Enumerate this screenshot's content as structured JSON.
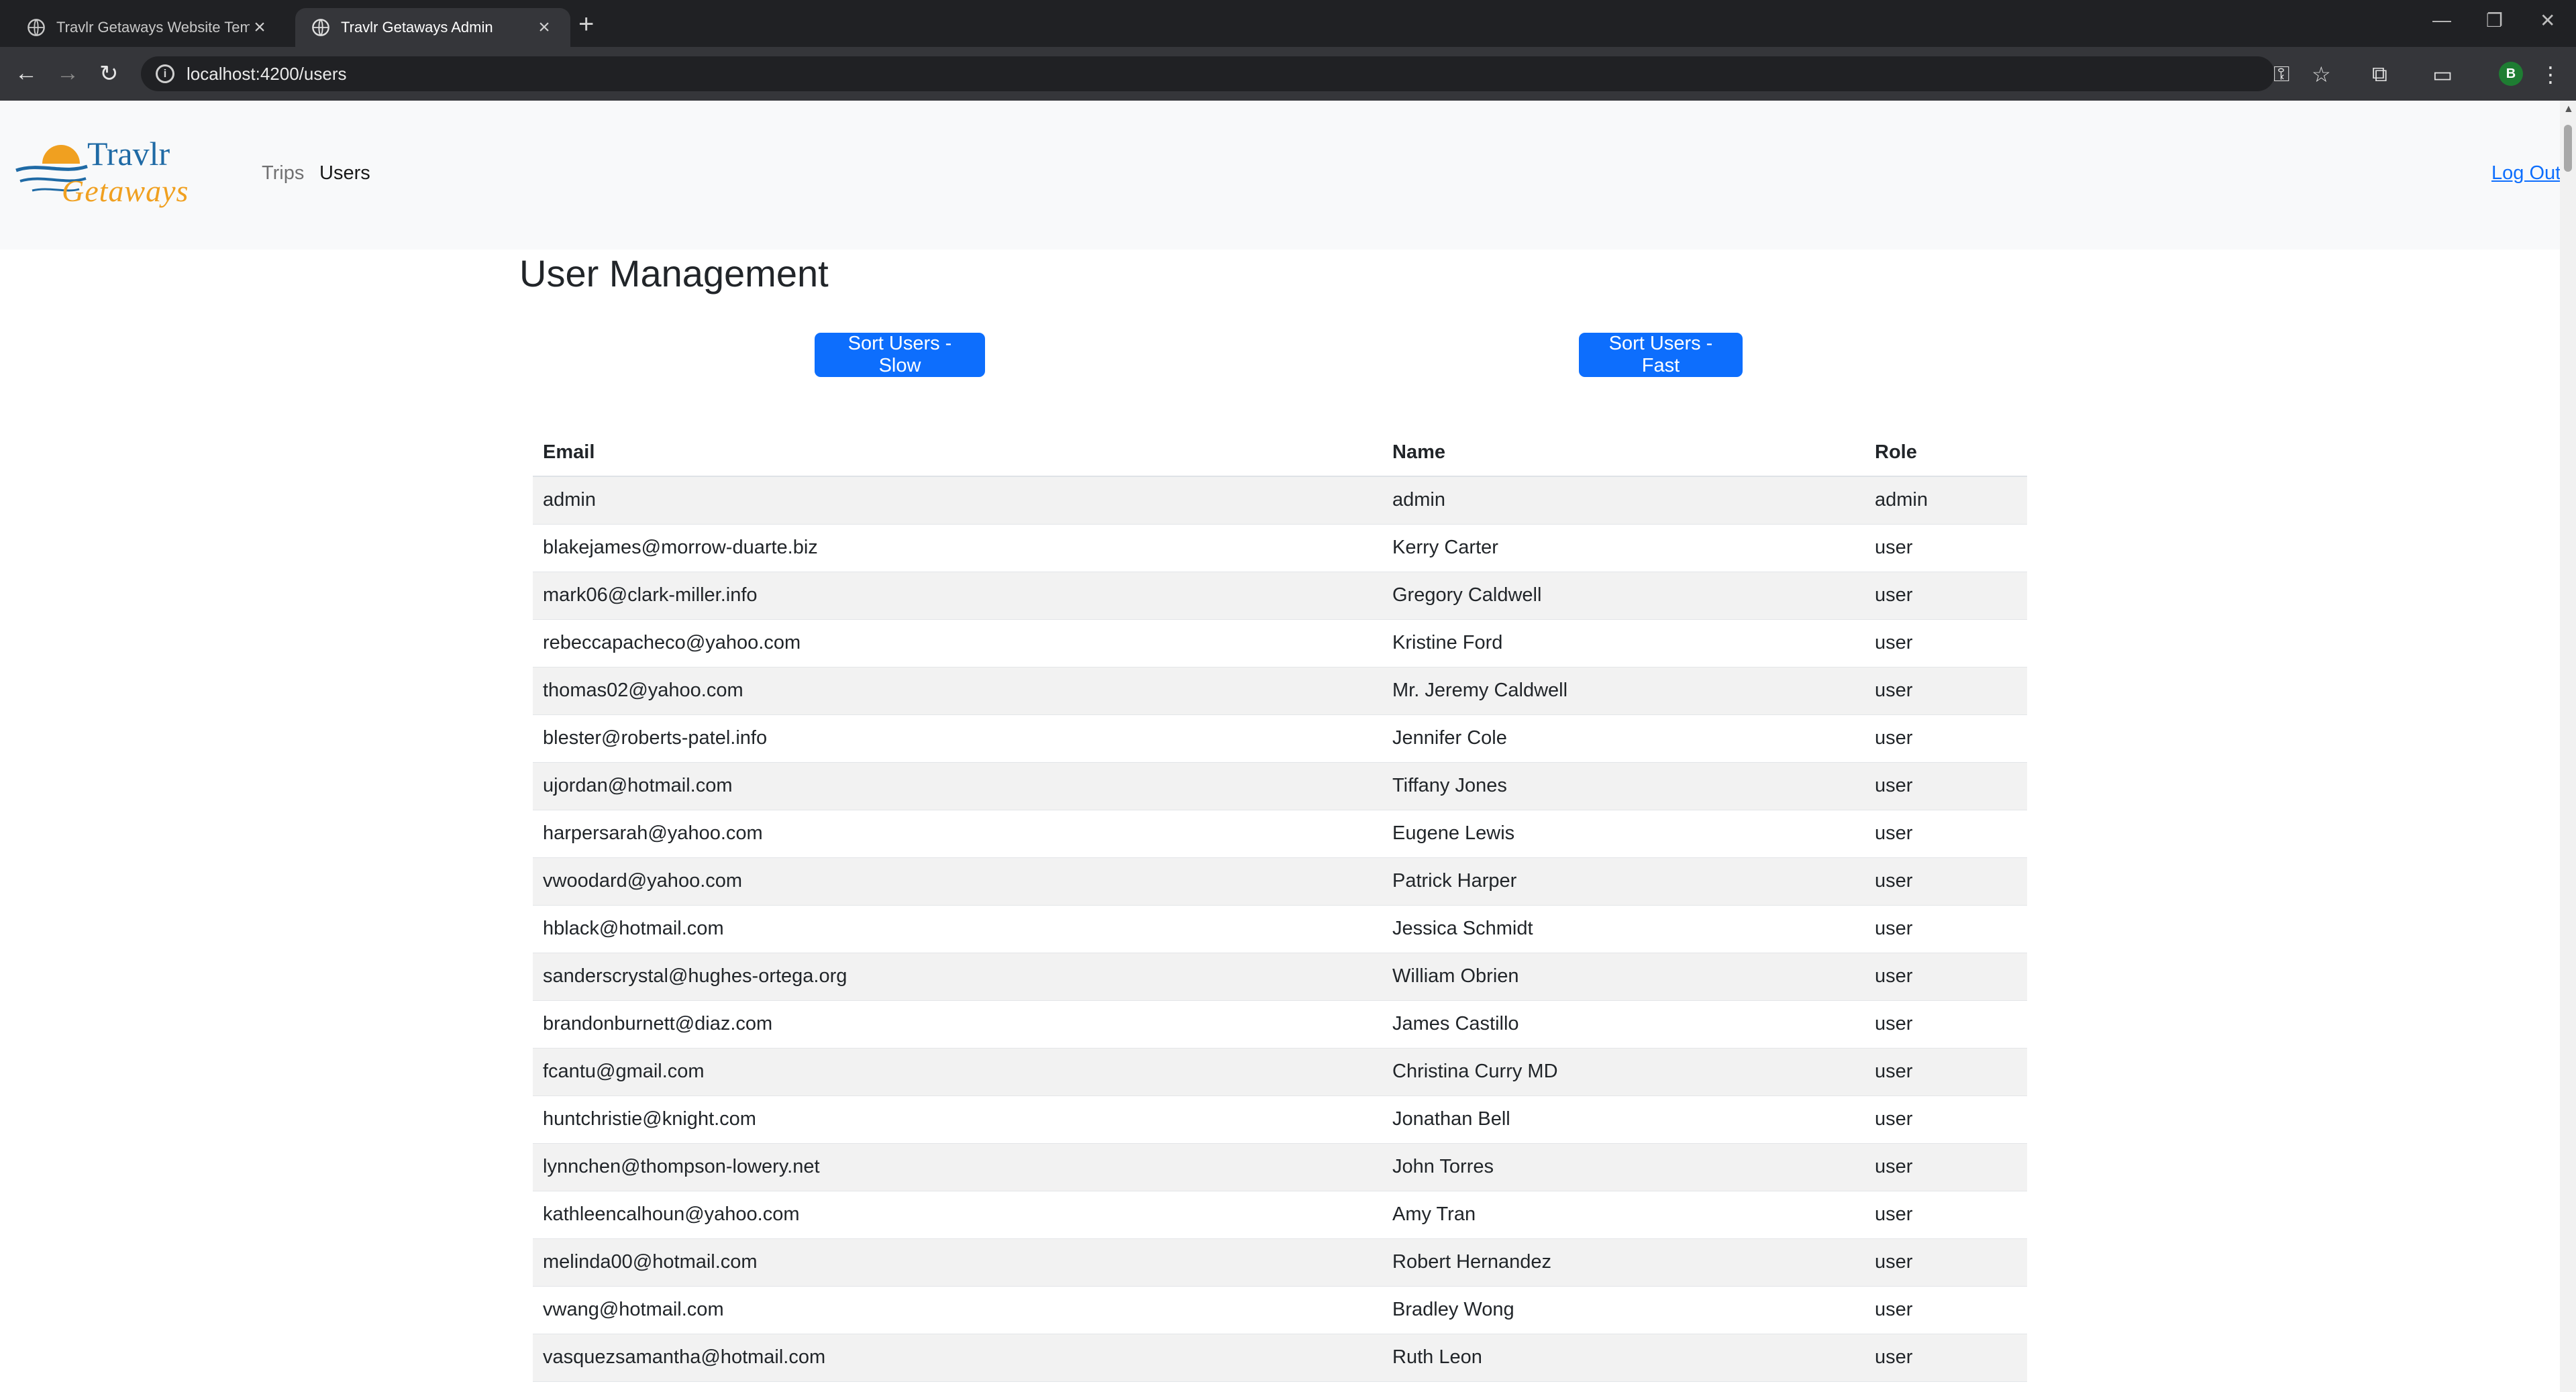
{
  "browser": {
    "tabs": [
      {
        "title": "Travlr Getaways Website Templ",
        "active": false
      },
      {
        "title": "Travlr Getaways Admin",
        "active": true
      }
    ],
    "url": "localhost:4200/users",
    "profile_initial": "B"
  },
  "navbar": {
    "brand_top": "Travlr",
    "brand_bottom": "Getaways",
    "links": [
      {
        "label": "Trips",
        "active": false
      },
      {
        "label": "Users",
        "active": true
      }
    ],
    "logout": "Log Out"
  },
  "page": {
    "title": "User Management",
    "sort_slow": "Sort Users - Slow",
    "sort_fast": "Sort Users - Fast"
  },
  "table": {
    "headers": [
      "Email",
      "Name",
      "Role"
    ],
    "rows": [
      [
        "admin",
        "admin",
        "admin"
      ],
      [
        "blakejames@morrow-duarte.biz",
        "Kerry Carter",
        "user"
      ],
      [
        "mark06@clark-miller.info",
        "Gregory Caldwell",
        "user"
      ],
      [
        "rebeccapacheco@yahoo.com",
        "Kristine Ford",
        "user"
      ],
      [
        "thomas02@yahoo.com",
        "Mr. Jeremy Caldwell",
        "user"
      ],
      [
        "blester@roberts-patel.info",
        "Jennifer Cole",
        "user"
      ],
      [
        "ujordan@hotmail.com",
        "Tiffany Jones",
        "user"
      ],
      [
        "harpersarah@yahoo.com",
        "Eugene Lewis",
        "user"
      ],
      [
        "vwoodard@yahoo.com",
        "Patrick Harper",
        "user"
      ],
      [
        "hblack@hotmail.com",
        "Jessica Schmidt",
        "user"
      ],
      [
        "sanderscrystal@hughes-ortega.org",
        "William Obrien",
        "user"
      ],
      [
        "brandonburnett@diaz.com",
        "James Castillo",
        "user"
      ],
      [
        "fcantu@gmail.com",
        "Christina Curry MD",
        "user"
      ],
      [
        "huntchristie@knight.com",
        "Jonathan Bell",
        "user"
      ],
      [
        "lynnchen@thompson-lowery.net",
        "John Torres",
        "user"
      ],
      [
        "kathleencalhoun@yahoo.com",
        "Amy Tran",
        "user"
      ],
      [
        "melinda00@hotmail.com",
        "Robert Hernandez",
        "user"
      ],
      [
        "vwang@hotmail.com",
        "Bradley Wong",
        "user"
      ],
      [
        "vasquezsamantha@hotmail.com",
        "Ruth Leon",
        "user"
      ]
    ]
  },
  "colors": {
    "primary": "#0d6efd",
    "navbar_bg": "#f8f9fa",
    "brand_blue": "#1f6aa5",
    "brand_orange": "#f0a020"
  }
}
